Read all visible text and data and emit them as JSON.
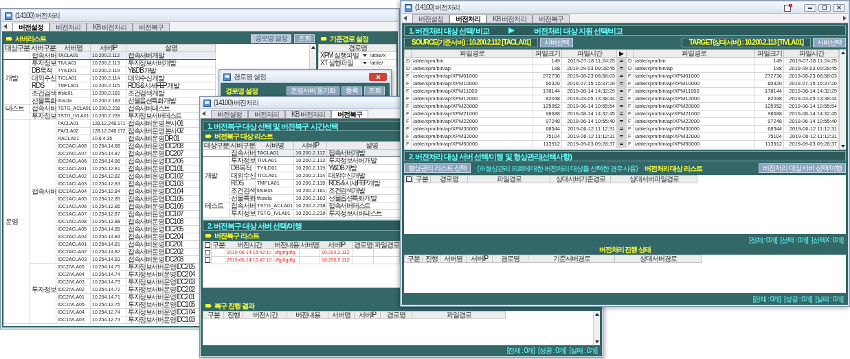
{
  "window_settings": {
    "title": "(14100) 버전처리",
    "tabs": [
      {
        "label": "버전설정",
        "selected": true
      },
      {
        "label": "버전처리",
        "selected": false
      },
      {
        "label": "KB 버전처리",
        "selected": false
      },
      {
        "label": "버전복구",
        "selected": false
      }
    ],
    "server_list": {
      "title": "서버리스트",
      "buttons": [
        {
          "label": "경로명 설정",
          "disabled": true
        },
        {
          "label": "조회",
          "disabled": false
        }
      ],
      "columns": [
        "대상구분",
        "서버구분",
        "서버명",
        "서버IP",
        "설명"
      ],
      "groups": [
        {
          "label": "개발",
          "subgroups": [
            {
              "label": "접속서버",
              "servers": [
                {
                  "name": "TACLA01",
                  "ip": "10.200.2.112",
                  "desc": "접속서버 개발",
                  "selected": true
                }
              ]
            },
            {
              "label": "투자정보",
              "servers": [
                {
                  "name": "TIVLA01",
                  "ip": "10.200.2.113",
                  "desc": "투자정보서버 개발",
                  "selected": false
                }
              ]
            },
            {
              "label": "DB목적",
              "servers": [
                {
                  "name": "TYILD01",
                  "ip": "10.200.2.119",
                  "desc": "YI&DB 개발",
                  "selected": false
                }
              ]
            },
            {
              "label": "대외수신",
              "servers": [
                {
                  "name": "TICLA01",
                  "ip": "10.200.2.114",
                  "desc": "대외수신 개발",
                  "selected": false
                }
              ]
            },
            {
              "label": "RDS",
              "servers": [
                {
                  "name": "TMFLA01",
                  "ip": "10.200.2.115",
                  "desc": "RDS & 시세FEP 개발",
                  "selected": false
                }
              ]
            },
            {
              "label": "조건검색",
              "servers": [
                {
                  "name": "tifsle01",
                  "ip": "10.200.2.181",
                  "desc": "조건검색 개발",
                  "selected": false
                }
              ]
            },
            {
              "label": "선물특화",
              "servers": [
                {
                  "name": "tfoscla",
                  "ip": "10.200.2.183",
                  "desc": "선물옵션특화 개발",
                  "selected": false
                }
              ]
            }
          ]
        },
        {
          "label": "테스트",
          "subgroups": [
            {
              "label": "접속서버",
              "servers": [
                {
                  "name": "TSTG_ACLA01",
                  "ip": "10.200.2.238",
                  "desc": "접속서버 테스트",
                  "selected": false
                }
              ]
            },
            {
              "label": "투자정보",
              "servers": [
                {
                  "name": "TSTG_IVLA01",
                  "ip": "10.200.2.239",
                  "desc": "투자정보서버 테스트",
                  "selected": false
                }
              ]
            }
          ]
        },
        {
          "label": "운영",
          "subgroups": [
            {
              "label": "접속서버",
              "servers": [
                {
                  "name": "PACLA01",
                  "ip": "128.12.248.171",
                  "desc": "접속서버 운영 본사 01",
                  "selected": false
                },
                {
                  "name": "PACLA02",
                  "ip": "128.12.248.172",
                  "desc": "접속서버 운영 본사 02",
                  "selected": false
                },
                {
                  "name": "RACLA01",
                  "ip": "10.6.4.35",
                  "desc": "접속서버 운영 DR 01",
                  "selected": false
                },
                {
                  "name": "IDC2ACLA08",
                  "ip": "10.254.14.88",
                  "desc": "접속서버 운영 IDC2 08",
                  "selected": false
                },
                {
                  "name": "IDC2ACLA07",
                  "ip": "10.254.14.87",
                  "desc": "접속서버 운영 IDC2 07",
                  "selected": false
                },
                {
                  "name": "IDC2ACLA06",
                  "ip": "10.254.14.86",
                  "desc": "접속서버 운영 IDC2 06",
                  "selected": false
                },
                {
                  "name": "IDC1ACLA01",
                  "ip": "10.254.12.81",
                  "desc": "접속서버 운영 IDC1 01",
                  "selected": false
                },
                {
                  "name": "IDC1ACLA02",
                  "ip": "10.254.12.82",
                  "desc": "접속서버 운영 IDC1 02",
                  "selected": false
                },
                {
                  "name": "IDC1ACLA03",
                  "ip": "10.254.12.83",
                  "desc": "접속서버 운영 IDC1 03",
                  "selected": false
                },
                {
                  "name": "IDC1ACLA04",
                  "ip": "10.254.12.84",
                  "desc": "접속서버 운영 IDC1 04",
                  "selected": false
                },
                {
                  "name": "IDC1ACLA05",
                  "ip": "10.254.12.85",
                  "desc": "접속서버 운영 IDC1 05",
                  "selected": false
                },
                {
                  "name": "IDC1ACLA06",
                  "ip": "10.254.12.86",
                  "desc": "접속서버 운영 IDC1 06",
                  "selected": false
                },
                {
                  "name": "IDC1ACLA07",
                  "ip": "10.254.12.87",
                  "desc": "접속서버 운영 IDC1 07",
                  "selected": false
                },
                {
                  "name": "IDC1ACLA08",
                  "ip": "10.254.12.88",
                  "desc": "접속서버 운영 IDC1 08",
                  "selected": false
                },
                {
                  "name": "IDC2ACLA05",
                  "ip": "10.254.14.85",
                  "desc": "접속서버 운영 IDC2 05",
                  "selected": false
                },
                {
                  "name": "IDC2ACLA04",
                  "ip": "10.254.14.84",
                  "desc": "접속서버 운영 IDC2 04",
                  "selected": false
                },
                {
                  "name": "IDC2ACLA01",
                  "ip": "10.254.14.81",
                  "desc": "접속서버 운영 IDC2 01",
                  "selected": false
                },
                {
                  "name": "IDC2ACLA02",
                  "ip": "10.254.14.82",
                  "desc": "접속서버 운영 IDC2 02",
                  "selected": false
                },
                {
                  "name": "IDC2ACLA03",
                  "ip": "10.254.14.83",
                  "desc": "접속서버 운영 IDC2 03",
                  "selected": false
                }
              ]
            },
            {
              "label": "투자정보",
              "servers": [
                {
                  "name": "IDC2IVLA05",
                  "ip": "10.254.14.75",
                  "desc": "투자정보서버 운영 IDC2 05",
                  "selected": false
                },
                {
                  "name": "IDC2IVLA04",
                  "ip": "10.254.14.74",
                  "desc": "투자정보서버 운영 IDC2 04",
                  "selected": false
                },
                {
                  "name": "IDC2IVLA03",
                  "ip": "10.254.14.73",
                  "desc": "투자정보서버 운영 IDC2 03",
                  "selected": false
                },
                {
                  "name": "IDC2IVLA02",
                  "ip": "10.254.14.72",
                  "desc": "투자정보서버 운영 IDC2 02",
                  "selected": false
                },
                {
                  "name": "IDC2IVLA01",
                  "ip": "10.254.14.71",
                  "desc": "투자정보서버 운영 IDC2 01",
                  "selected": false
                },
                {
                  "name": "IDC1IVLA05",
                  "ip": "10.254.12.75",
                  "desc": "투자정보서버 운영 IDC1 05",
                  "selected": false
                },
                {
                  "name": "IDC1IVLA04",
                  "ip": "10.254.12.74",
                  "desc": "투자정보서버 운영 IDC1 04",
                  "selected": false
                },
                {
                  "name": "IDC1IVLA03",
                  "ip": "10.254.12.73",
                  "desc": "투자정보서버 운영 IDC1 03",
                  "selected": false
                }
              ]
            }
          ]
        }
      ]
    },
    "base_path": {
      "title": "기준경로 설정",
      "column": "경로명",
      "rows": [
        {
          "name": "XPM 실행파일",
          "path": "/able/x"
        },
        {
          "name": "XT 실행파일",
          "path": "/able/"
        }
      ]
    }
  },
  "path_popup": {
    "title": "경로명 설정",
    "heading": "경로명 설정",
    "buttons": [
      "운영서버 동기화",
      "등록",
      "조회"
    ]
  },
  "window_restore": {
    "title": "(14100) 버전처리",
    "tabs": [
      {
        "label": "버전설정",
        "selected": false
      },
      {
        "label": "버전처리",
        "selected": false
      },
      {
        "label": "KB 버전처리",
        "selected": false
      },
      {
        "label": "버전복구",
        "selected": true
      }
    ],
    "section1_title": "1. 버전복구 대상 선택 및 버전복구 시간선택",
    "target_list": {
      "title": "버전복구 대상 리스트",
      "columns": [
        "대상구분",
        "서버구분",
        "서버명",
        "서버IP",
        "설명"
      ],
      "groups": [
        {
          "label": "개발",
          "subgroups": [
            {
              "label": "접속서버",
              "servers": [
                {
                  "name": "TACLA01",
                  "ip": "10.200.2.112",
                  "desc": "접속서버 개발",
                  "selected": true
                }
              ]
            },
            {
              "label": "투자정보",
              "servers": [
                {
                  "name": "TIVLA01",
                  "ip": "10.200.2.113",
                  "desc": "투자정보서버 개발",
                  "selected": false
                }
              ]
            },
            {
              "label": "DB목적",
              "servers": [
                {
                  "name": "TYILD01",
                  "ip": "10.200.2.119",
                  "desc": "YI&DB 개발",
                  "selected": false
                }
              ]
            },
            {
              "label": "대외수신",
              "servers": [
                {
                  "name": "TICLA01",
                  "ip": "10.200.2.114",
                  "desc": "대외수신 개발",
                  "selected": false
                }
              ]
            },
            {
              "label": "RDS",
              "servers": [
                {
                  "name": "TMFLA01",
                  "ip": "10.200.2.115",
                  "desc": "RDS & 시세FEP 개발",
                  "selected": false
                }
              ]
            },
            {
              "label": "조건검색",
              "servers": [
                {
                  "name": "tifsle01",
                  "ip": "10.200.2.181",
                  "desc": "조건검색 개발",
                  "selected": false
                }
              ]
            },
            {
              "label": "선물특화",
              "servers": [
                {
                  "name": "tfoscla",
                  "ip": "10.200.2.183",
                  "desc": "선물옵션특화 개발",
                  "selected": false
                }
              ]
            }
          ]
        },
        {
          "label": "테스트",
          "subgroups": [
            {
              "label": "접속서버",
              "servers": [
                {
                  "name": "TSTG_ACLA01",
                  "ip": "10.200.2.238",
                  "desc": "접속서버 테스트",
                  "selected": false
                }
              ]
            },
            {
              "label": "투자정보",
              "servers": [
                {
                  "name": "TSTG_IVLA01",
                  "ip": "10.200.2.239",
                  "desc": "투자정보서버 테스트",
                  "selected": false
                }
              ]
            }
          ]
        }
      ]
    },
    "section2_title": "2. 버전복구 대상 서버 선택/이행",
    "restore_list": {
      "title": "버전복구 리스트",
      "all_checked": false,
      "columns": [
        "구분",
        "버전시간",
        "버전내용",
        "서버명",
        "서버IP",
        "경로명",
        "파일경로"
      ],
      "rows": [
        {
          "checked": false,
          "time": "2019-06-14 15:42:10",
          "content": "dfgdfgdfg",
          "ip": "10.200.2.112"
        },
        {
          "checked": false,
          "time": "2019-06-14 15:42:10",
          "content": "dfgdfgdfg",
          "ip": "10.200.2.112"
        }
      ]
    },
    "result": {
      "title": "복구 진행 결과",
      "columns": [
        "구분",
        "진행",
        "버전시간",
        "버전내용",
        "서버명",
        "서버IP",
        "경로명",
        "파일경로"
      ],
      "status": [
        "[전체 : 0개]",
        "[성공 : 0개]",
        "[실패 : 0개]"
      ]
    }
  },
  "window_process": {
    "title": "(14100) 버전처리",
    "tabs": [
      {
        "label": "버전설정",
        "selected": false
      },
      {
        "label": "버전처리",
        "selected": true
      },
      {
        "label": "KB 버전처리",
        "selected": false
      },
      {
        "label": "버전복구",
        "selected": false
      }
    ],
    "section1": {
      "title": "1. 버전처리 대상 선택/ 비교",
      "subtitle": "버전처리 대상 지원 선택/비교"
    },
    "source": {
      "label": "SOURCE(기준서버) : 10.200.2.112 [TACLA01]",
      "button": "서버선택"
    },
    "target": {
      "label": "TARGET(상대서버) : 10.200.2.113 [TIVLA01]",
      "button": "서버선택"
    },
    "compare": {
      "source_columns": [
        "파일경로",
        "파일크기",
        "파일시간"
      ],
      "target_columns": [
        "파일경로",
        "파일크기",
        "파일시간"
      ],
      "rows": [
        {
          "source": {
            "type": "D",
            "path": "/able/xpm/bin",
            "size": "149",
            "time": "2019-07-18 11:24:25"
          },
          "result": "=",
          "target": {
            "type": "D",
            "path": "/able/xpm/bin",
            "size": "149",
            "time": "2019-07-18 11:24:25"
          }
        },
        {
          "source": {
            "type": "D",
            "path": "/able/xpm/bin/ap",
            "size": "198",
            "time": "2019-09-03 09:28:45"
          },
          "result": "=",
          "target": {
            "type": "D",
            "path": "/able/xpm/bin/ap",
            "size": "198",
            "time": "2019-09-03 09:28:45"
          }
        },
        {
          "source": {
            "type": "F",
            "path": "/able/xpm/bin/ap/XPM01000",
            "size": "272736",
            "time": "2019-08-23 08:58:03"
          },
          "result": "=",
          "target": {
            "type": "F",
            "path": "/able/xpm/bin/ap/XPM01000",
            "size": "272736",
            "time": "2019-08-23 08:58:03"
          }
        },
        {
          "source": {
            "type": "F",
            "path": "/able/xpm/bin/ap/XPM10000",
            "size": "60320",
            "time": "2019-07-15 16:37:20"
          },
          "result": "=",
          "target": {
            "type": "F",
            "path": "/able/xpm/bin/ap/XPM10000",
            "size": "60320",
            "time": "2019-07-15 16:37:20"
          }
        },
        {
          "source": {
            "type": "F",
            "path": "/able/xpm/bin/ap/XPM11000",
            "size": "178144",
            "time": "2019-08-14 14:32:29"
          },
          "result": "=",
          "target": {
            "type": "F",
            "path": "/able/xpm/bin/ap/XPM11000",
            "size": "178144",
            "time": "2019-08-14 14:32:29"
          }
        },
        {
          "source": {
            "type": "F",
            "path": "/able/xpm/bin/ap/XPM12000",
            "size": "82048",
            "time": "2019-03-05 13:38:44"
          },
          "result": "=",
          "target": {
            "type": "F",
            "path": "/able/xpm/bin/ap/XPM12000",
            "size": "82048",
            "time": "2019-03-05 13:38:44"
          }
        },
        {
          "source": {
            "type": "F",
            "path": "/able/xpm/bin/ap/XPM20000",
            "size": "125952",
            "time": "2019-06-14 10:55:54"
          },
          "result": "=",
          "target": {
            "type": "F",
            "path": "/able/xpm/bin/ap/XPM20000",
            "size": "125952",
            "time": "2019-06-14 10:55:54"
          }
        },
        {
          "source": {
            "type": "F",
            "path": "/able/xpm/bin/ap/XPM21000",
            "size": "98688",
            "time": "2019-08-14 14:32:45"
          },
          "result": "=",
          "target": {
            "type": "F",
            "path": "/able/xpm/bin/ap/XPM21000",
            "size": "98688",
            "time": "2019-08-14 14:32:45"
          }
        },
        {
          "source": {
            "type": "F",
            "path": "/able/xpm/bin/ap/XPM22000",
            "size": "97248",
            "time": "2019-06-14 10:55:40"
          },
          "result": "=",
          "target": {
            "type": "F",
            "path": "/able/xpm/bin/ap/XPM22000",
            "size": "97248",
            "time": "2019-06-14 10:55:40"
          }
        },
        {
          "source": {
            "type": "F",
            "path": "/able/xpm/bin/ap/XPM30000",
            "size": "68544",
            "time": "2019-06-12 11:12:31"
          },
          "result": "=",
          "target": {
            "type": "F",
            "path": "/able/xpm/bin/ap/XPM30000",
            "size": "68544",
            "time": "2019-06-12 11:12:31"
          }
        },
        {
          "source": {
            "type": "F",
            "path": "/able/xpm/bin/ap/XPM32000",
            "size": "75104",
            "time": "2019-06-12 11:12:31"
          },
          "result": "=",
          "target": {
            "type": "F",
            "path": "/able/xpm/bin/ap/XPM32000",
            "size": "75104",
            "time": "2019-06-12 11:12:31"
          }
        },
        {
          "source": {
            "type": "F",
            "path": "/able/xpm/bin/ap/XPM50000",
            "size": "113912",
            "time": "2019-09-03 09:28:37"
          },
          "result": "=",
          "target": {
            "type": "F",
            "path": "/able/xpm/bin/ap/XPM50000",
            "size": "113912",
            "time": "2019-09-03 09:28:37"
          }
        }
      ]
    },
    "section2": {
      "title": "2. 버전처리 대상 서버 선택/이행 및 형상관리(선택사항)",
      "left_button": "형상관리 리스트 선택",
      "note": "(※형상관리 의뢰에 대한 버전처리 대상을 선택한 경우 사용)",
      "list_title": "버전처리 대상 리스트",
      "right_button": "버전처리 대상 서버 선택/이행",
      "all_checked": false,
      "columns": [
        "구분",
        "경로명",
        "파일경로",
        "상대서버기준경로",
        "상대서버파일경로"
      ],
      "status": [
        "[전체 : 0개]",
        "[선택 : 0개]",
        "[선택X : 0개]"
      ]
    },
    "progress": {
      "title": "버전처리 진행 상태",
      "columns": [
        "구분",
        "진행",
        "서버명",
        "서버IP",
        "경로명",
        "기준서버경로",
        "상대서버경로"
      ],
      "status": [
        "[전체 : 0개]",
        "[성공 : 0개]",
        "[실패 : 0개]"
      ]
    }
  }
}
